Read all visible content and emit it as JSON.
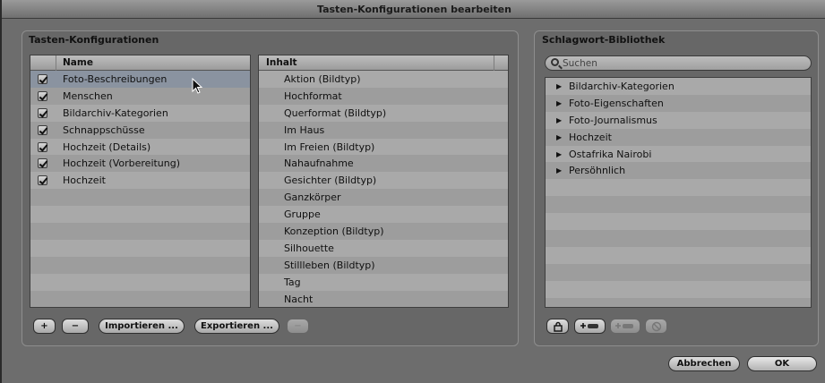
{
  "window": {
    "title": "Tasten-Konfigurationen bearbeiten"
  },
  "left_panel": {
    "title": "Tasten-Konfigurationen",
    "name_header": "Name",
    "content_header": "Inhalt",
    "configs": [
      {
        "name": "Foto-Beschreibungen",
        "checked": true,
        "selected": true
      },
      {
        "name": "Menschen",
        "checked": true
      },
      {
        "name": "Bildarchiv-Kategorien",
        "checked": true
      },
      {
        "name": "Schnappschüsse",
        "checked": true
      },
      {
        "name": "Hochzeit (Details)",
        "checked": true
      },
      {
        "name": "Hochzeit (Vorbereitung)",
        "checked": true
      },
      {
        "name": "Hochzeit",
        "checked": true
      }
    ],
    "content_items": [
      "Aktion (Bildtyp)",
      "Hochformat",
      "Querformat (Bildtyp)",
      "Im Haus",
      "Im Freien (Bildtyp)",
      "Nahaufnahme",
      "Gesichter (Bildtyp)",
      "Ganzkörper",
      "Gruppe",
      "Konzeption (Bildtyp)",
      "Silhouette",
      "Stillleben (Bildtyp)",
      "Tag",
      "Nacht"
    ],
    "buttons": {
      "add": "+",
      "remove": "−",
      "import": "Importieren ...",
      "export": "Exportieren ...",
      "remove_content": "−"
    }
  },
  "right_panel": {
    "title": "Schlagwort-Bibliothek",
    "search_placeholder": "Suchen",
    "items": [
      "Bildarchiv-Kategorien",
      "Foto-Eigenschaften",
      "Foto-Journalismus",
      "Hochzeit",
      "Ostafrika Nairobi",
      "Persöhnlich"
    ],
    "tree_arrow": "▶",
    "tool_icons": [
      "lock-icon",
      "add-keyword-icon",
      "add-subkeyword-icon",
      "no-entry-icon"
    ]
  },
  "footer": {
    "cancel": "Abbrechen",
    "ok": "OK"
  }
}
